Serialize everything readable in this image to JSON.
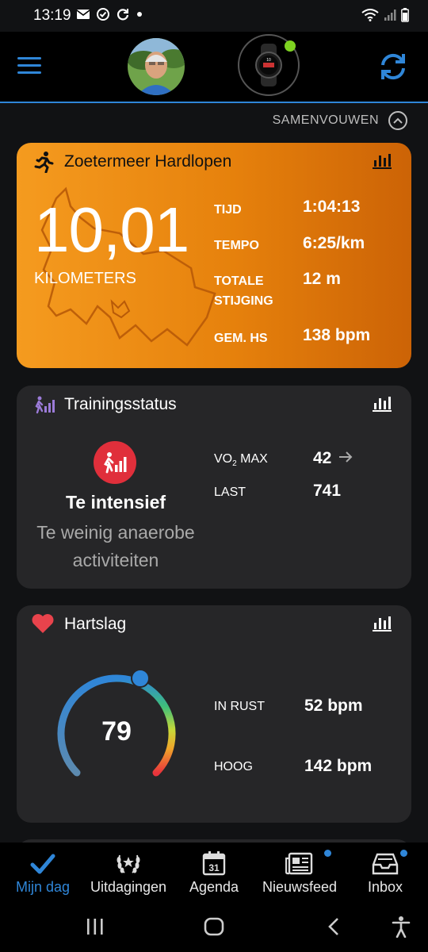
{
  "status_bar": {
    "time": "13:19",
    "icons": [
      "mail-icon",
      "check-circle-icon",
      "sync-icon",
      "dot-icon",
      "wifi-icon",
      "signal-icon",
      "battery-icon"
    ]
  },
  "header": {
    "menu_icon": "hamburger-menu-icon",
    "avatar_alt": "profielfoto",
    "watch_icon": "watch-icon",
    "sync_icon": "sync-icon",
    "accent": "#2f86d8"
  },
  "collapse": {
    "label": "SAMENVOUWEN",
    "icon": "chevron-up-icon"
  },
  "activity_card": {
    "title": "Zoetermeer Hardlopen",
    "distance": "10,01",
    "unit": "KILOMETERS",
    "stats": [
      {
        "label": "TIJD",
        "value": "1:04:13"
      },
      {
        "label": "TEMPO",
        "value": "6:25/km"
      },
      {
        "label": "TOTALE STIJGING",
        "label_line1": "TOTALE",
        "label_line2": "STIJGING",
        "value": "12 m"
      },
      {
        "label": "GEM. HS",
        "value": "138 bpm"
      }
    ],
    "gradient": [
      "#f59b1f",
      "#cc6306"
    ]
  },
  "training_card": {
    "title": "Trainingsstatus",
    "status": "Te intensief",
    "description_line1": "Te weinig anaerobe",
    "description_line2": "activiteiten",
    "vo2_label_a": "VO",
    "vo2_label_sub": "2",
    "vo2_label_b": " MAX",
    "vo2_value": "42",
    "vo2_trend_icon": "arrow-right-icon",
    "load_label": "LAST",
    "load_value": "741",
    "status_color": "#e02f3b"
  },
  "hr_card": {
    "title": "Hartslag",
    "current": "79",
    "resting_label": "IN RUST",
    "resting_value": "52 bpm",
    "high_label": "HOOG",
    "high_value": "142 bpm",
    "heart_color": "#e8434c"
  },
  "bottom_nav": [
    {
      "label": "Mijn dag",
      "icon": "check-icon",
      "active": true
    },
    {
      "label": "Uitdagingen",
      "icon": "laurel-icon",
      "active": false
    },
    {
      "label": "Agenda",
      "icon": "calendar-icon",
      "calendar_day": "31",
      "active": false
    },
    {
      "label": "Nieuwsfeed",
      "icon": "newsfeed-icon",
      "active": false,
      "badge": true
    },
    {
      "label": "Inbox",
      "icon": "inbox-icon",
      "active": false,
      "badge": true
    }
  ]
}
